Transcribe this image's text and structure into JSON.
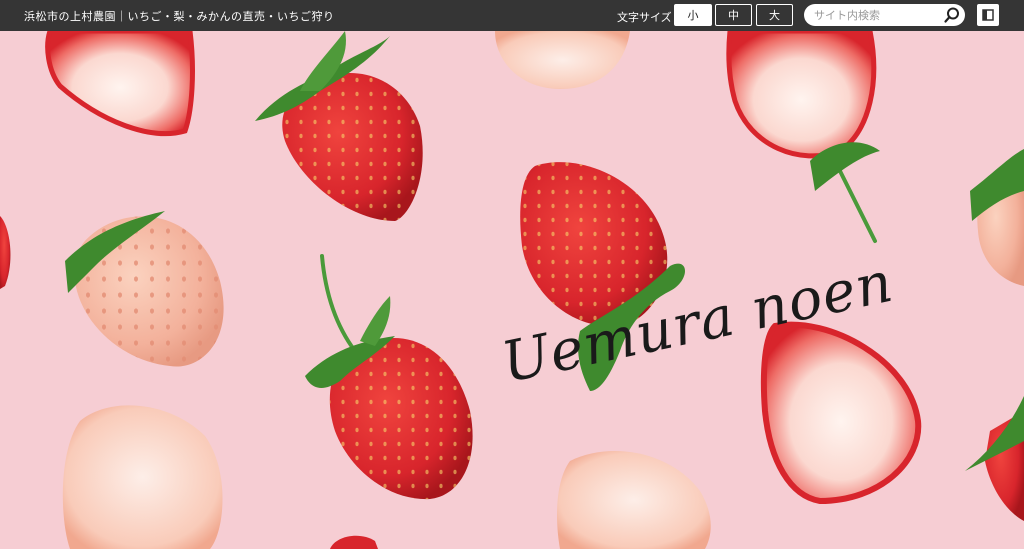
{
  "header": {
    "site_description": "浜松市の上村農園｜いちご・梨・みかんの直売・いちご狩り",
    "font_size": {
      "label": "文字サイズ",
      "options": [
        "小",
        "中",
        "大"
      ],
      "selected": "小"
    },
    "search": {
      "placeholder": "サイト内検索",
      "value": ""
    },
    "icons": {
      "search": "search-icon",
      "menu": "menu-icon"
    }
  },
  "hero": {
    "logo_text": "Uemura noen",
    "colors": {
      "background": "#f6cdd3",
      "strawberry_red": "#d8252c",
      "white_strawberry": "#f3b19b",
      "leaf": "#3f8a2e"
    }
  }
}
